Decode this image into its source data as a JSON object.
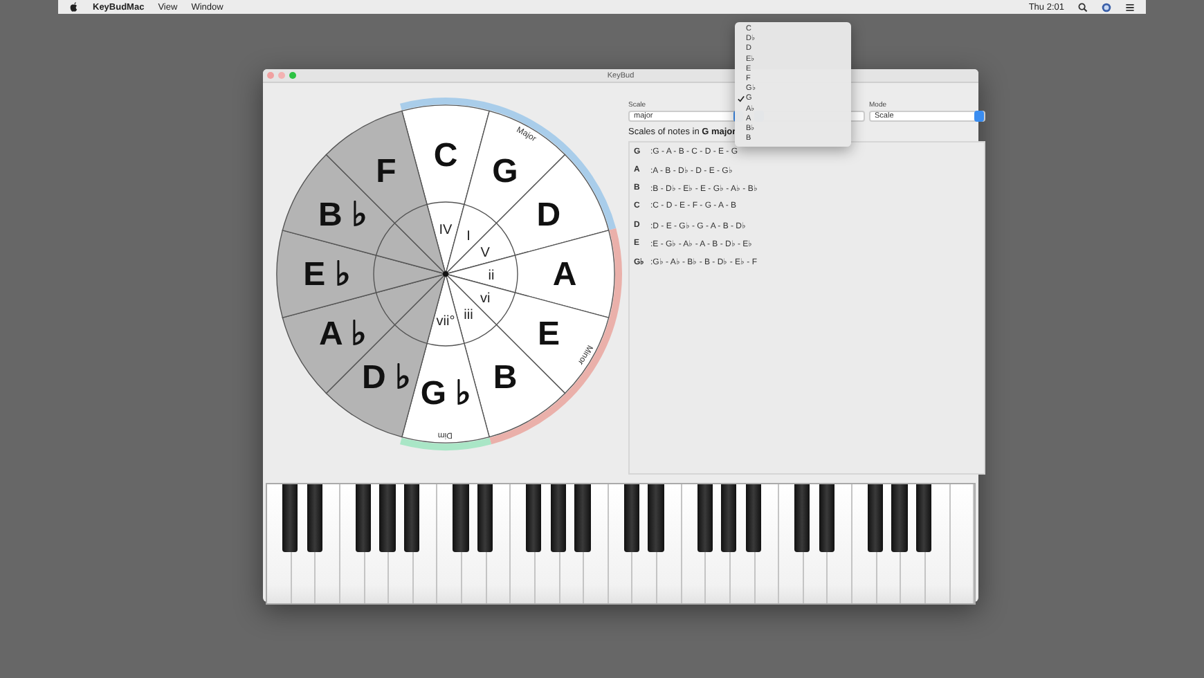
{
  "menu_bar": {
    "app_name": "KeyBudMac",
    "menus": [
      "View",
      "Window"
    ],
    "clock": "Thu 2:01"
  },
  "window": {
    "title": "KeyBud"
  },
  "circle": {
    "groups": [
      {
        "label": "Major",
        "color": "#a9cdea",
        "segments": [
          {
            "note": "C",
            "numeral": "IV",
            "in_scale": true
          },
          {
            "note": "G",
            "numeral": "I",
            "in_scale": true
          },
          {
            "note": "D",
            "numeral": "V",
            "in_scale": true
          }
        ]
      },
      {
        "label": "Minor",
        "color": "#eab0aa",
        "segments": [
          {
            "note": "A",
            "numeral": "ii",
            "in_scale": true
          },
          {
            "note": "E",
            "numeral": "vi",
            "in_scale": true
          },
          {
            "note": "B",
            "numeral": "iii",
            "in_scale": true
          }
        ]
      },
      {
        "label": "Dim",
        "color": "#a9e6c6",
        "segments": [
          {
            "note": "G ♭",
            "numeral": "vii°",
            "in_scale": true
          }
        ]
      },
      {
        "segments": [
          {
            "note": "F",
            "in_scale": false
          },
          {
            "note": "B ♭",
            "in_scale": false
          },
          {
            "note": "E ♭",
            "in_scale": false
          },
          {
            "note": "A ♭",
            "in_scale": false
          },
          {
            "note": "D ♭",
            "in_scale": false
          }
        ]
      }
    ]
  },
  "controls": {
    "scale_label": "Scale",
    "scale_value": "major",
    "mode_label": "Mode",
    "mode_value": "Scale"
  },
  "key_menu": [
    {
      "label": "C",
      "selected": false
    },
    {
      "label": "D♭",
      "selected": false
    },
    {
      "label": "D",
      "selected": false
    },
    {
      "label": "E♭",
      "selected": false
    },
    {
      "label": "E",
      "selected": false
    },
    {
      "label": "F",
      "selected": false
    },
    {
      "label": "G♭",
      "selected": false
    },
    {
      "label": "G",
      "selected": true
    },
    {
      "label": "A♭",
      "selected": false
    },
    {
      "label": "A",
      "selected": false
    },
    {
      "label": "B♭",
      "selected": false
    },
    {
      "label": "B",
      "selected": false
    }
  ],
  "scales": {
    "heading": "Scales of notes in **G major**",
    "rows": [
      {
        "key": "G",
        "notes": ":G - A - B - C - D - E - G"
      },
      {
        "key": "A",
        "notes": ":A - B - D♭ - D - E - G♭"
      },
      {
        "key": "B",
        "notes": ":B - D♭ - E♭ - E - G♭ - A♭ - B♭"
      },
      {
        "key": "C",
        "notes": ":C - D - E - F - G - A - B"
      },
      {
        "key": "D",
        "notes": ":D - E - G♭ - G - A - B - D♭"
      },
      {
        "key": "E",
        "notes": ":E - G♭ - A♭ - A - B - D♭ - E♭"
      },
      {
        "key": "G♭",
        "notes": ":G♭ - A♭ - B♭ - B - D♭ - E♭ - F"
      }
    ]
  }
}
